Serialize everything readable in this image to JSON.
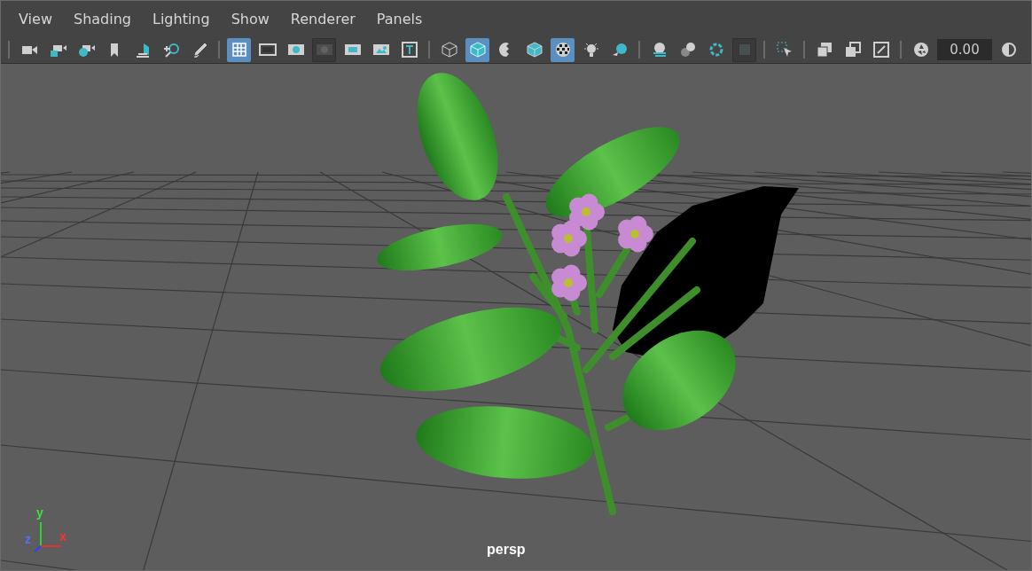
{
  "menu": [
    "View",
    "Shading",
    "Lighting",
    "Show",
    "Renderer",
    "Panels"
  ],
  "toolbar": {
    "groups": [
      [
        {
          "selected": false,
          "disabled": false
        },
        {
          "selected": false,
          "disabled": false
        },
        {
          "selected": false,
          "disabled": false
        },
        {
          "selected": false,
          "disabled": false
        },
        {
          "selected": false,
          "disabled": false
        },
        {
          "selected": false,
          "disabled": false
        },
        {
          "selected": false,
          "disabled": false
        }
      ],
      [
        {
          "selected": true,
          "disabled": false
        },
        {
          "selected": false,
          "disabled": false
        },
        {
          "selected": false,
          "disabled": false
        },
        {
          "selected": false,
          "disabled": true
        },
        {
          "selected": false,
          "disabled": false
        },
        {
          "selected": false,
          "disabled": false
        },
        {
          "selected": false,
          "disabled": false
        }
      ],
      [
        {
          "selected": false,
          "disabled": false
        },
        {
          "selected": true,
          "disabled": false
        },
        {
          "selected": false,
          "disabled": false
        },
        {
          "selected": false,
          "disabled": false
        },
        {
          "selected": true,
          "disabled": false
        },
        {
          "selected": false,
          "disabled": false
        },
        {
          "selected": false,
          "disabled": false
        }
      ],
      [
        {
          "selected": false,
          "disabled": false
        },
        {
          "selected": false,
          "disabled": false
        },
        {
          "selected": false,
          "disabled": false
        },
        {
          "selected": false,
          "disabled": true
        }
      ],
      [
        {
          "selected": false,
          "disabled": false
        }
      ],
      [
        {
          "selected": false,
          "disabled": false
        },
        {
          "selected": false,
          "disabled": false
        },
        {
          "selected": false,
          "disabled": false
        }
      ]
    ],
    "exposure_value": "0.00"
  },
  "viewport": {
    "axis_labels": {
      "x": "x",
      "y": "y",
      "z": "z"
    },
    "camera": "persp"
  }
}
